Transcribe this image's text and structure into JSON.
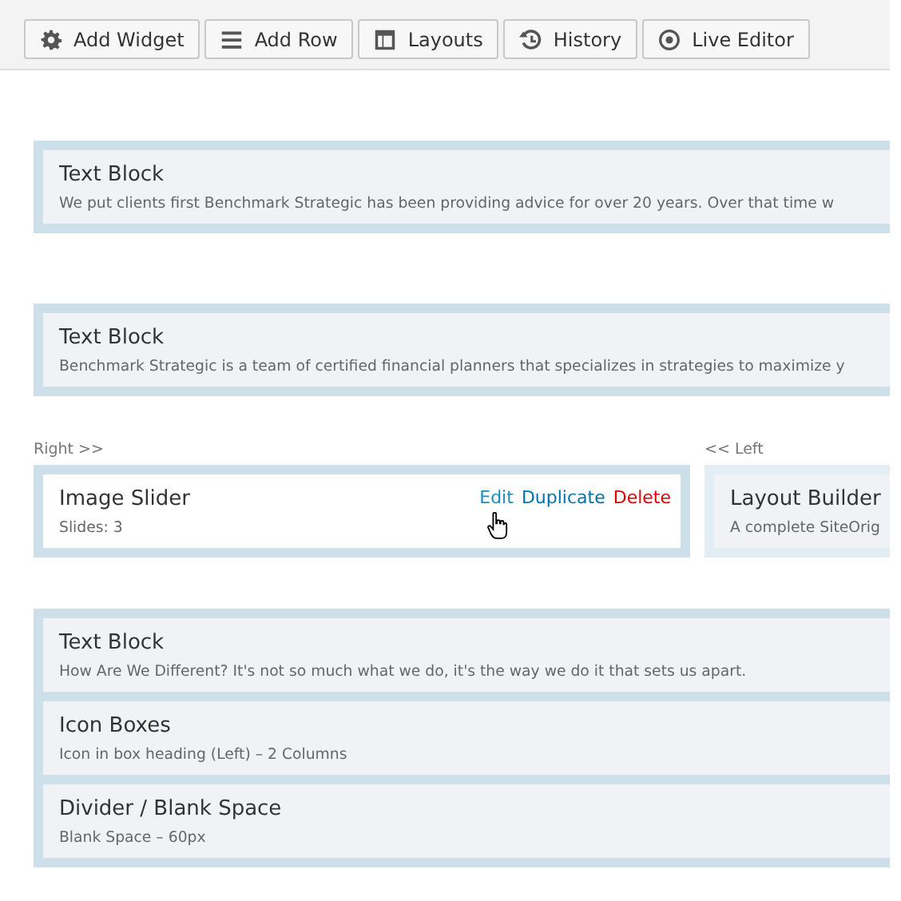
{
  "toolbar": {
    "buttons": [
      {
        "label": "Add Widget"
      },
      {
        "label": "Add Row"
      },
      {
        "label": "Layouts"
      },
      {
        "label": "History"
      },
      {
        "label": "Live Editor"
      }
    ]
  },
  "rows": [
    {
      "kind": "single",
      "widgets": [
        {
          "title": "Text Block",
          "description": "We put clients first Benchmark Strategic has been providing advice for over 20 years. Over that time w",
          "hovered": false
        }
      ]
    },
    {
      "kind": "single",
      "widgets": [
        {
          "title": "Text Block",
          "description": "Benchmark Strategic is a team of certified financial planners that specializes in strategies to maximize y",
          "hovered": false
        }
      ]
    },
    {
      "kind": "columns",
      "columns": [
        {
          "label": "Right >>",
          "selected": true,
          "widgets": [
            {
              "title": "Image Slider",
              "description": "Slides: 3",
              "hovered": true,
              "actions": [
                {
                  "label": "Edit",
                  "kind": "edit"
                },
                {
                  "label": "Duplicate",
                  "kind": "duplicate"
                },
                {
                  "label": "Delete",
                  "kind": "delete"
                }
              ]
            }
          ]
        },
        {
          "label": "<< Left",
          "selected": false,
          "widgets": [
            {
              "title": "Layout Builder",
              "description": "A complete SiteOrig",
              "hovered": false
            }
          ]
        }
      ]
    },
    {
      "kind": "single",
      "widgets": [
        {
          "title": "Text Block",
          "description": "How Are We Different? It's not so much what we do, it's the way we do it that sets us apart.",
          "hovered": false
        },
        {
          "title": "Icon Boxes",
          "description": "Icon in box heading (Left)  –  2 Columns",
          "hovered": false
        },
        {
          "title": "Divider / Blank Space",
          "description": "Blank Space  –  60px",
          "hovered": false
        }
      ]
    }
  ]
}
